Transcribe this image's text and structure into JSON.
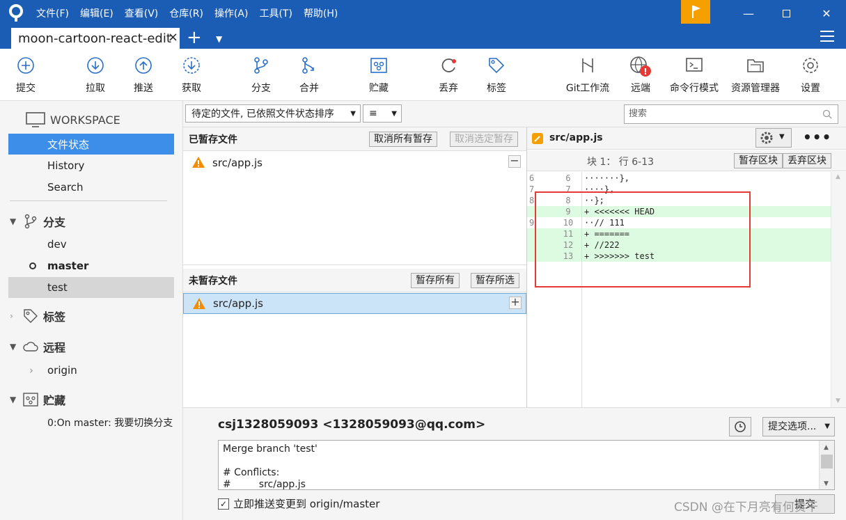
{
  "menu": [
    "文件(F)",
    "编辑(E)",
    "查看(V)",
    "仓库(R)",
    "操作(A)",
    "工具(T)",
    "帮助(H)"
  ],
  "tab": {
    "title": "moon-cartoon-react-edit",
    "close": "×",
    "new": "+"
  },
  "toolbar": [
    "提交",
    "拉取",
    "推送",
    "获取",
    "分支",
    "合并",
    "贮藏",
    "丢弃",
    "标签",
    "Git工作流",
    "远端",
    "命令行模式",
    "资源管理器",
    "设置"
  ],
  "sidebar": {
    "workspace": "WORKSPACE",
    "workspace_items": [
      "文件状态",
      "History",
      "Search"
    ],
    "branches_title": "分支",
    "branches": [
      "dev",
      "master",
      "test"
    ],
    "tags_title": "标签",
    "remotes_title": "远程",
    "remotes": [
      "origin"
    ],
    "stash_title": "贮藏",
    "stashes": [
      "0:On master: 我要切换分支"
    ]
  },
  "filter": {
    "sort_label": "待定的文件, 已依照文件状态排序",
    "view_icon": "≡",
    "search_placeholder": "搜索"
  },
  "staged": {
    "title": "已暂存文件",
    "unstage_all": "取消所有暂存",
    "unstage_selected": "取消选定暂存",
    "files": [
      "src/app.js"
    ]
  },
  "unstaged": {
    "title": "未暂存文件",
    "stage_all": "暂存所有",
    "stage_selected": "暂存所选",
    "files": [
      "src/app.js"
    ]
  },
  "diff": {
    "file": "src/app.js",
    "hunk": "块 1： 行 6-13",
    "stage_hunk": "暂存区块",
    "discard_hunk": "丢弃区块",
    "lines": [
      {
        "old": "6",
        "new": "6",
        "text": "·······},",
        "add": false
      },
      {
        "old": "7",
        "new": "7",
        "text": "····},",
        "add": false
      },
      {
        "old": "8",
        "new": "8",
        "text": "··};",
        "add": false
      },
      {
        "old": "",
        "new": "9",
        "text": "+ <<<<<<< HEAD",
        "add": true
      },
      {
        "old": "9",
        "new": "10",
        "text": "··// 111",
        "add": false
      },
      {
        "old": "",
        "new": "11",
        "text": "+ =======",
        "add": true
      },
      {
        "old": "",
        "new": "12",
        "text": "+ //222",
        "add": true
      },
      {
        "old": "",
        "new": "13",
        "text": "+ >>>>>>> test",
        "add": true
      }
    ]
  },
  "commit": {
    "author": "csj1328059093 <1328059093@qq.com>",
    "options": "提交选项...",
    "message_lines": [
      "Merge branch 'test'",
      "",
      "# Conflicts:",
      "#         src/app.js"
    ],
    "push_label": "立即推送变更到 origin/master",
    "commit_button": "提交"
  },
  "watermark": "CSDN @在下月亮有何贵干",
  "colors": {
    "titlebar": "#1b5db5",
    "selection": "#3d8ee8",
    "added": "#ddfbe0",
    "warning": "#f28c00",
    "highlight": "#e53935"
  }
}
